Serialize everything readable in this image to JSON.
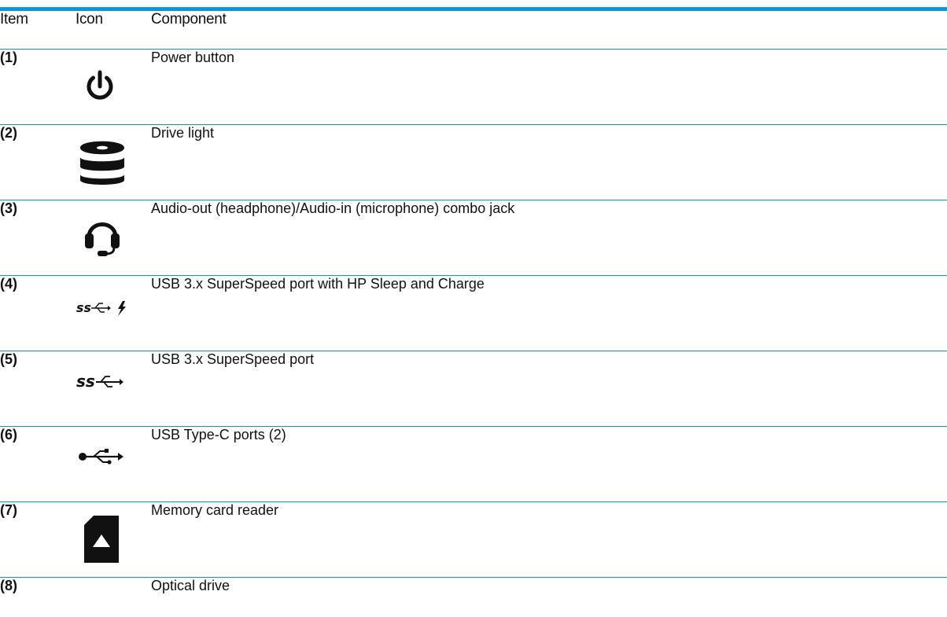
{
  "table": {
    "headers": {
      "item": "Item",
      "icon": "Icon",
      "component": "Component"
    },
    "rows": [
      {
        "item": "(1)",
        "icon": "power-icon",
        "component": "Power button"
      },
      {
        "item": "(2)",
        "icon": "drive-light-icon",
        "component": "Drive light"
      },
      {
        "item": "(3)",
        "icon": "headset-icon",
        "component": "Audio-out (headphone)/Audio-in (microphone) combo jack"
      },
      {
        "item": "(4)",
        "icon": "usb-superspeed-charge-icon",
        "component": "USB 3.x SuperSpeed port with HP Sleep and Charge"
      },
      {
        "item": "(5)",
        "icon": "usb-superspeed-icon",
        "component": "USB 3.x SuperSpeed port"
      },
      {
        "item": "(6)",
        "icon": "usb-icon",
        "component": "USB Type-C ports (2)"
      },
      {
        "item": "(7)",
        "icon": "memory-card-icon",
        "component": "Memory card reader"
      },
      {
        "item": "(8)",
        "icon": "",
        "component": "Optical drive"
      }
    ]
  },
  "colors": {
    "rule": "#0d96d8",
    "text": "#111111"
  }
}
